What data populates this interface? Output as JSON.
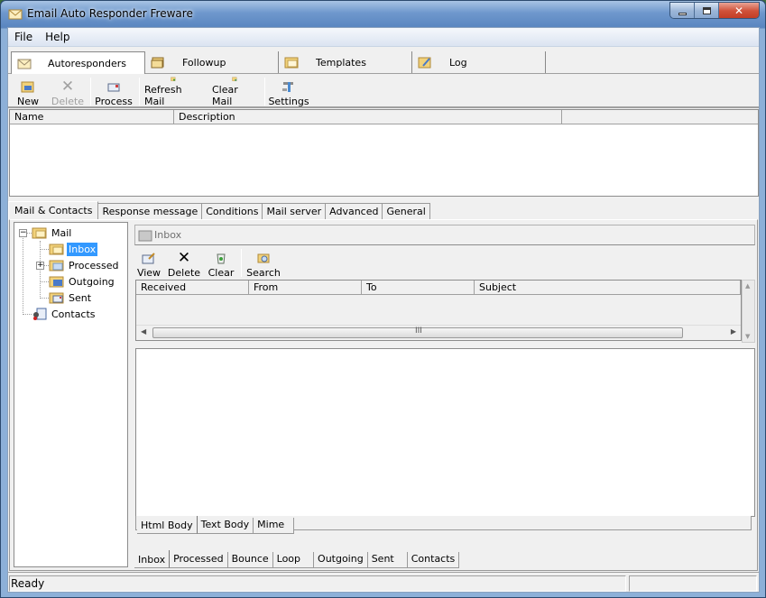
{
  "window": {
    "title": "Email Auto Responder Freware",
    "controls": {
      "minimize": "minimize",
      "maximize": "maximize",
      "close": "close"
    }
  },
  "menu": [
    "File",
    "Help"
  ],
  "top_tabs": [
    {
      "label": "Autoresponders",
      "icon": "envelope-icon",
      "active": true
    },
    {
      "label": "Followup",
      "icon": "mail-stack-icon",
      "active": false
    },
    {
      "label": "Templates",
      "icon": "folder-envelope-icon",
      "active": false
    },
    {
      "label": "Log",
      "icon": "log-icon",
      "active": false
    }
  ],
  "toolbar": [
    {
      "label": "New",
      "icon": "new-icon",
      "enabled": true
    },
    {
      "label": "Delete",
      "icon": "delete-x-icon",
      "enabled": false
    },
    {
      "label": "Process",
      "icon": "process-icon",
      "enabled": true
    },
    {
      "label": "Refresh Mail",
      "icon": "refresh-mail-icon",
      "enabled": true
    },
    {
      "label": "Clear Mail",
      "icon": "clear-mail-icon",
      "enabled": true
    },
    {
      "label": "Settings",
      "icon": "settings-icon",
      "enabled": true
    }
  ],
  "autoresponder_list": {
    "columns": [
      "Name",
      "Description",
      ""
    ],
    "rows": []
  },
  "detail_tabs": [
    {
      "label": "Mail & Contacts",
      "active": true
    },
    {
      "label": "Response message",
      "active": false
    },
    {
      "label": "Conditions",
      "active": false
    },
    {
      "label": "Mail server",
      "active": false
    },
    {
      "label": "Advanced",
      "active": false
    },
    {
      "label": "General",
      "active": false
    }
  ],
  "tree": {
    "root": {
      "label": "Mail",
      "expanded": true
    },
    "children": [
      {
        "label": "Inbox",
        "selected": true,
        "expandable": false
      },
      {
        "label": "Processed",
        "selected": false,
        "expandable": true
      },
      {
        "label": "Outgoing",
        "selected": false,
        "expandable": false
      },
      {
        "label": "Sent",
        "selected": false,
        "expandable": false
      }
    ],
    "contacts": {
      "label": "Contacts"
    }
  },
  "folder_header": {
    "label": "Inbox"
  },
  "mail_toolbar": [
    {
      "label": "View",
      "icon": "view-icon"
    },
    {
      "label": "Delete",
      "icon": "delete-x-icon"
    },
    {
      "label": "Clear",
      "icon": "recycle-bin-icon"
    },
    {
      "label": "Search",
      "icon": "search-icon"
    }
  ],
  "mail_list": {
    "columns": [
      "Received",
      "From",
      "To",
      "Subject"
    ],
    "rows": []
  },
  "body_tabs": [
    {
      "label": "Html Body",
      "active": true
    },
    {
      "label": "Text Body",
      "active": false
    },
    {
      "label": "Mime",
      "active": false
    }
  ],
  "folder_tabs": [
    {
      "label": "Inbox",
      "active": true
    },
    {
      "label": "Processed",
      "active": false
    },
    {
      "label": "Bounce",
      "active": false
    },
    {
      "label": "Loop",
      "active": false
    },
    {
      "label": "Outgoing",
      "active": false
    },
    {
      "label": "Sent",
      "active": false
    },
    {
      "label": "Contacts",
      "active": false
    }
  ],
  "status": {
    "text": "Ready",
    "panel2": ""
  },
  "scrollbar": {
    "grip": "III"
  }
}
